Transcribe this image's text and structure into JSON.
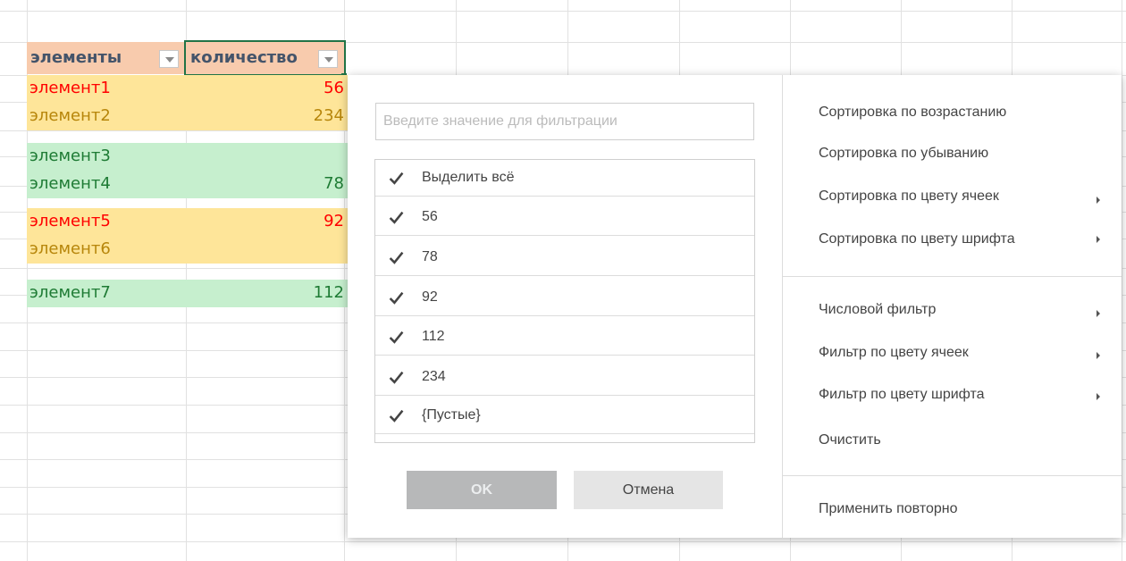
{
  "sheet": {
    "headers": {
      "col1": "элементы",
      "col2": "количество"
    },
    "rows": [
      {
        "name": "элемент1",
        "value": "56",
        "color": "#ff0000",
        "bg": "#fee599"
      },
      {
        "name": "элемент2",
        "value": "234",
        "color": "#b7860b",
        "bg": "#fee599"
      },
      {
        "name": "элемент3",
        "value": "",
        "color": "#1e7b34",
        "bg": "#c6efce"
      },
      {
        "name": "элемент4",
        "value": "78",
        "color": "#1e7b34",
        "bg": "#c6efce"
      },
      {
        "name": "элемент5",
        "value": "92",
        "color": "#ff0000",
        "bg": "#fee599"
      },
      {
        "name": "элемент6",
        "value": "",
        "color": "#b7860b",
        "bg": "#fee599"
      },
      {
        "name": "элемент7",
        "value": "112",
        "color": "#1e7b34",
        "bg": "#c6efce"
      }
    ]
  },
  "filter": {
    "search_placeholder": "Введите значение для фильтрации",
    "items": [
      {
        "label": "Выделить всё",
        "checked": true
      },
      {
        "label": "56",
        "checked": true
      },
      {
        "label": "78",
        "checked": true
      },
      {
        "label": "92",
        "checked": true
      },
      {
        "label": "112",
        "checked": true
      },
      {
        "label": "234",
        "checked": true
      },
      {
        "label": "{Пустые}",
        "checked": true
      }
    ],
    "ok_label": "OK",
    "cancel_label": "Отмена"
  },
  "menu": {
    "sort_asc": "Сортировка по возрастанию",
    "sort_desc": "Сортировка по убыванию",
    "sort_cell_color": "Сортировка по цвету ячеек",
    "sort_font_color": "Сортировка по цвету шрифта",
    "number_filter": "Числовой фильтр",
    "filter_cell_color": "Фильтр по цвету ячеек",
    "filter_font_color": "Фильтр по цвету шрифта",
    "clear": "Очистить",
    "reapply": "Применить повторно"
  },
  "colors": {
    "header_bg": "#f8cbad",
    "header_text": "#44546a",
    "selected_border": "#217346",
    "ok_bg": "#b7b8b9"
  }
}
